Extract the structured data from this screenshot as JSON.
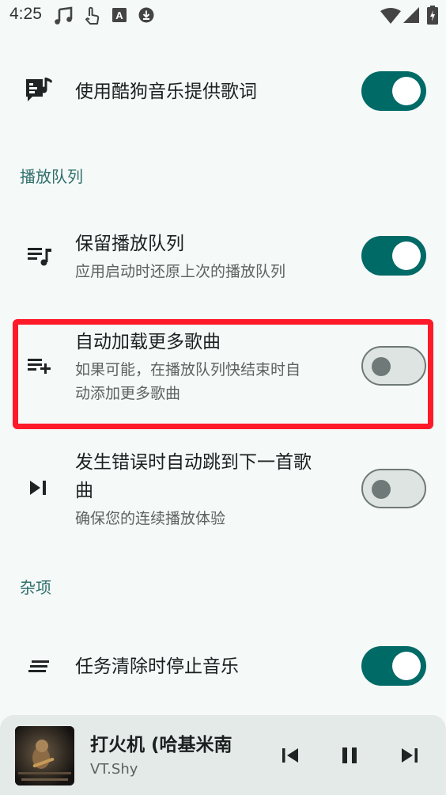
{
  "status_bar": {
    "time": "4:25"
  },
  "settings": {
    "kugou_lyrics": {
      "title": "使用酷狗音乐提供歌词",
      "enabled": true
    },
    "queue_section": {
      "header": "播放队列"
    },
    "keep_queue": {
      "title": "保留播放队列",
      "subtitle": "应用启动时还原上次的播放队列",
      "enabled": true
    },
    "auto_load_more": {
      "title": "自动加载更多歌曲",
      "subtitle_line1": "如果可能，在播放队列快结束时自",
      "subtitle_line2": "动添加更多歌曲",
      "enabled": false
    },
    "auto_skip_on_error": {
      "title_line1": "发生错误时自动跳到下一首歌",
      "title_line2": "曲",
      "subtitle": "确保您的连续播放体验",
      "enabled": false
    },
    "misc_section": {
      "header": "杂项"
    },
    "stop_on_clear": {
      "title": "任务清除时停止音乐",
      "enabled": true
    }
  },
  "player": {
    "song_title": "打火机 (哈基米南",
    "artist": "VT.Shy"
  },
  "colors": {
    "accent": "#006a67",
    "highlight": "#ff1a2a",
    "section_header": "#2f6f6c"
  }
}
